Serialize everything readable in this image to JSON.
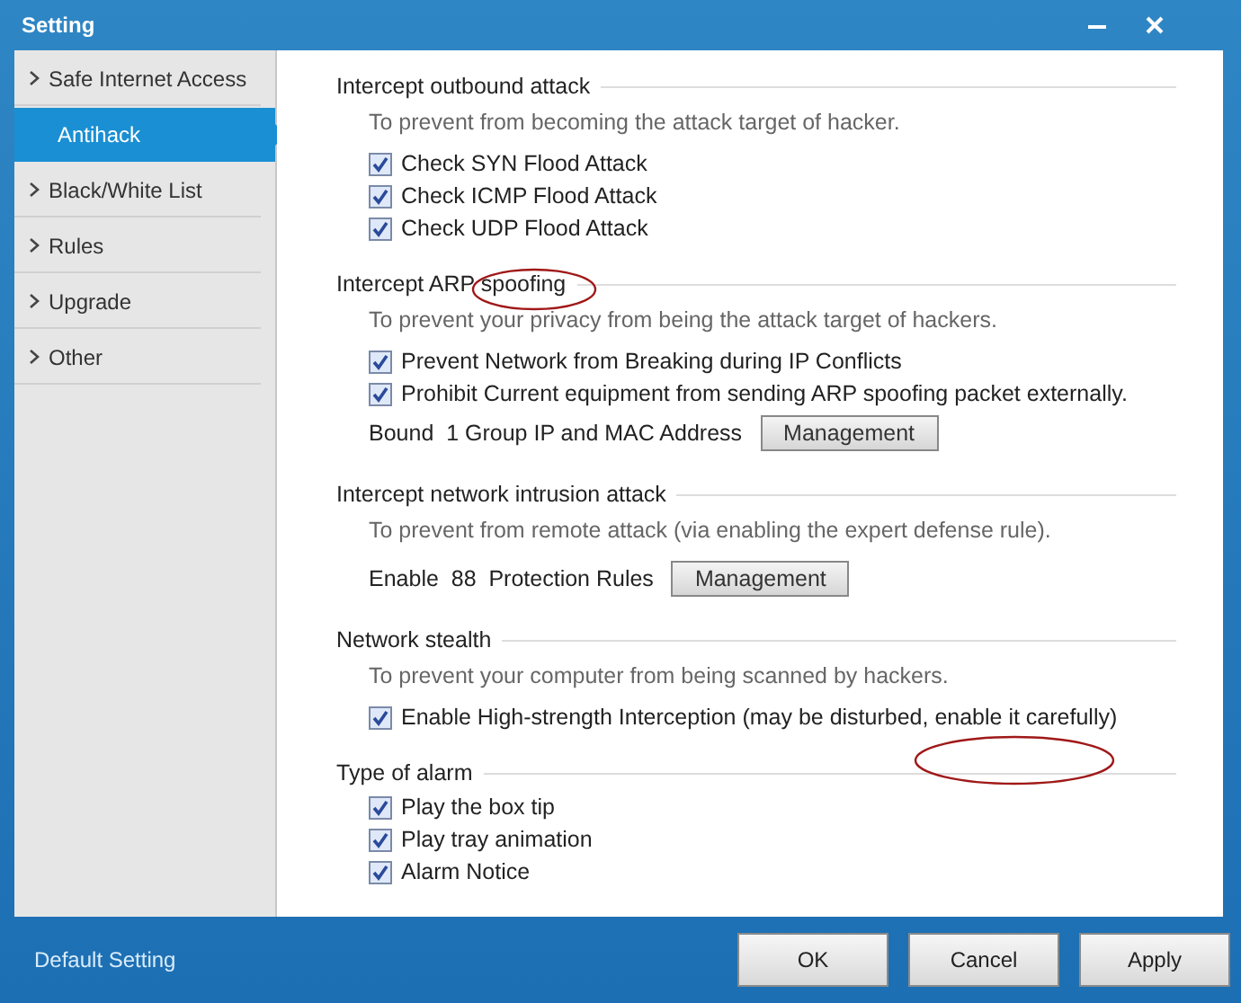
{
  "window": {
    "title": "Setting"
  },
  "sidebar": {
    "items": [
      {
        "label": "Safe Internet Access",
        "selected": false
      },
      {
        "label": "Antihack",
        "selected": true
      },
      {
        "label": "Black/White List",
        "selected": false
      },
      {
        "label": "Rules",
        "selected": false
      },
      {
        "label": "Upgrade",
        "selected": false
      },
      {
        "label": "Other",
        "selected": false
      }
    ]
  },
  "sections": [
    {
      "title": "Intercept outbound attack",
      "description": "To prevent from becoming the attack target of hacker.",
      "items": [
        {
          "kind": "checkbox",
          "label": "Check SYN Flood Attack",
          "checked": true
        },
        {
          "kind": "checkbox",
          "label": "Check ICMP Flood Attack",
          "checked": true
        },
        {
          "kind": "checkbox",
          "label": "Check UDP Flood Attack",
          "checked": true
        }
      ]
    },
    {
      "title": "Intercept ARP spoofing",
      "description": "To prevent your privacy from being the attack target of hackers.",
      "items": [
        {
          "kind": "checkbox",
          "label": "Prevent Network from Breaking during IP Conflicts",
          "checked": true
        },
        {
          "kind": "checkbox",
          "label": "Prohibit Current equipment from sending ARP spoofing packet externally.",
          "checked": true
        },
        {
          "kind": "action",
          "label": "Bound  1 Group IP and MAC Address",
          "button": "Management"
        }
      ]
    },
    {
      "title": "Intercept network intrusion attack",
      "description": "To prevent from remote attack (via enabling the expert defense rule).",
      "items": [
        {
          "kind": "action",
          "label": "Enable  88  Protection Rules",
          "button": "Management"
        }
      ]
    },
    {
      "title": "Network stealth",
      "description": "To prevent your computer from being scanned by hackers.",
      "items": [
        {
          "kind": "checkbox",
          "label": "Enable High-strength Interception (may be disturbed, enable it carefully)",
          "checked": true
        }
      ]
    },
    {
      "title": "Type of alarm",
      "items": [
        {
          "kind": "checkbox",
          "label": "Play the box tip",
          "checked": true
        },
        {
          "kind": "checkbox",
          "label": "Play tray animation",
          "checked": true
        },
        {
          "kind": "checkbox",
          "label": "Alarm Notice",
          "checked": true
        }
      ]
    }
  ],
  "footer": {
    "link": "Default Setting",
    "buttons": [
      "OK",
      "Cancel",
      "Apply"
    ]
  }
}
